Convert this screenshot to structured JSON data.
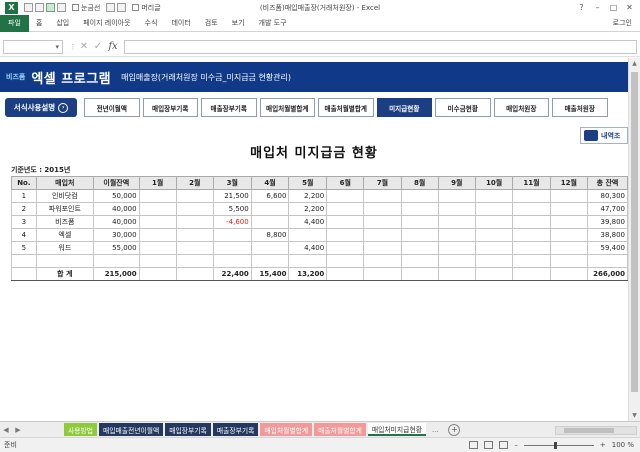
{
  "window": {
    "title": "(비즈폼)매입매출장(거래처원장) - Excel",
    "quick_checkbox_1": "눈금선",
    "quick_checkbox_2": "머리글",
    "controls": [
      "?",
      "–",
      "□",
      "✕"
    ]
  },
  "ribbon": {
    "tabs": [
      "파일",
      "홈",
      "삽입",
      "페이지 레이아웃",
      "수식",
      "데이터",
      "검토",
      "보기",
      "개발 도구"
    ],
    "login": "로그인"
  },
  "formula_bar": {
    "namebox": "",
    "fx_label": "fx",
    "value": ""
  },
  "banner": {
    "brand_small": "비즈폼",
    "brand_big": "엑셀 프로그램",
    "subtitle": "매입매출장(거래처원장 미수금_미지급금 현황관리)"
  },
  "nav": {
    "guide_label": "서식사용설명",
    "tabs": [
      {
        "label": "전년이월액",
        "active": false
      },
      {
        "label": "매입장부기록",
        "active": false
      },
      {
        "label": "매출장부기록",
        "active": false
      },
      {
        "label": "매입처월별합계",
        "active": false
      },
      {
        "label": "매출처월별합계",
        "active": false
      },
      {
        "label": "미지급현황",
        "active": true
      },
      {
        "label": "미수금현황",
        "active": false
      },
      {
        "label": "매입처원장",
        "active": false
      },
      {
        "label": "매출처원장",
        "active": false
      }
    ]
  },
  "detail_button": "내역조",
  "report": {
    "title": "매입처 미지급금 현황",
    "year_label": "기준년도 : 2015년",
    "columns": [
      "No.",
      "매입처",
      "이월잔액",
      "1월",
      "2월",
      "3월",
      "4월",
      "5월",
      "6월",
      "7월",
      "8월",
      "9월",
      "10월",
      "11월",
      "12월",
      "총 잔액"
    ],
    "rows": [
      [
        "1",
        "인비닷컴",
        "50,000",
        "",
        "",
        "21,500",
        "6,600",
        "2,200",
        "",
        "",
        "",
        "",
        "",
        "",
        "",
        "80,300"
      ],
      [
        "2",
        "파워포인트",
        "40,000",
        "",
        "",
        "5,500",
        "",
        "2,200",
        "",
        "",
        "",
        "",
        "",
        "",
        "",
        "47,700"
      ],
      [
        "3",
        "비즈폼",
        "40,000",
        "",
        "",
        "-4,600",
        "",
        "4,400",
        "",
        "",
        "",
        "",
        "",
        "",
        "",
        "39,800"
      ],
      [
        "4",
        "엑셀",
        "30,000",
        "",
        "",
        "",
        "8,800",
        "",
        "",
        "",
        "",
        "",
        "",
        "",
        "",
        "38,800"
      ],
      [
        "5",
        "워드",
        "55,000",
        "",
        "",
        "",
        "",
        "4,400",
        "",
        "",
        "",
        "",
        "",
        "",
        "",
        "59,400"
      ],
      [
        "",
        "",
        "",
        "",
        "",
        "",
        "",
        "",
        "",
        "",
        "",
        "",
        "",
        "",
        "",
        ""
      ]
    ],
    "total_row": [
      "",
      "합   계",
      "215,000",
      "",
      "",
      "22,400",
      "15,400",
      "13,200",
      "",
      "",
      "",
      "",
      "",
      "",
      "",
      "266,000"
    ]
  },
  "sheet_tabs": [
    {
      "label": "사용방법",
      "style": "green"
    },
    {
      "label": "매입매출전년이월액",
      "style": "navy"
    },
    {
      "label": "매입장부기록",
      "style": "navy"
    },
    {
      "label": "매출장부기록",
      "style": "navy"
    },
    {
      "label": "매입처월별합계",
      "style": "pink"
    },
    {
      "label": "매출처월별합계",
      "style": "pink"
    },
    {
      "label": "매입처미지급현황",
      "style": "active"
    },
    {
      "label": "...",
      "style": "more"
    }
  ],
  "status": {
    "ready": "준비",
    "zoom": "100 %"
  }
}
